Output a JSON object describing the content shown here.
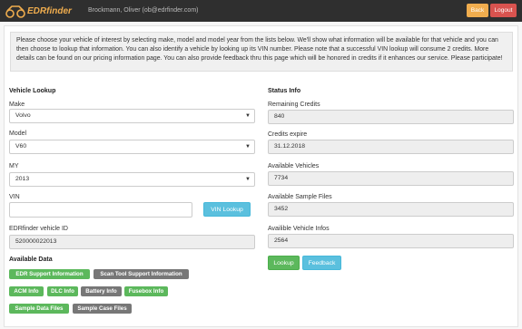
{
  "header": {
    "logo_text": "EDRfinder",
    "user": "Brockmann, Oliver (ob@edrfinder.com)",
    "back_label": "Back",
    "logout_label": "Logout"
  },
  "intro": "Please choose your vehicle of interest by selecting make, model and model year from the lists below. We'll show what information will be available for that vehicle and you can then choose to lookup that information. You can also identify a vehicle by looking up its VIN number. Please note that a successful VIN lookup will consume 2 credits. More details can be found on our pricing information page. You can also provide feedback thru this page which will be honored in credits if it enhances our service. Please participate!",
  "lookup": {
    "title": "Vehicle Lookup",
    "make_label": "Make",
    "make_value": "Volvo",
    "model_label": "Model",
    "model_value": "V60",
    "my_label": "MY",
    "my_value": "2013",
    "vin_label": "VIN",
    "vin_value": "",
    "vin_button": "VIN Lookup",
    "id_label": "EDRfinder vehicle ID",
    "id_value": "520000022013"
  },
  "available": {
    "title": "Available Data",
    "badges": [
      {
        "label": "EDR Support Information",
        "status": "available"
      },
      {
        "label": "Scan Tool Support Information",
        "status": "unavailable"
      },
      {
        "label": "ACM Info",
        "status": "available"
      },
      {
        "label": "DLC Info",
        "status": "available"
      },
      {
        "label": "Battery Info",
        "status": "unavailable"
      },
      {
        "label": "Fusebox Info",
        "status": "available"
      },
      {
        "label": "Sample Data Files",
        "status": "available"
      },
      {
        "label": "Sample Case Files",
        "status": "unavailable"
      }
    ]
  },
  "status": {
    "title": "Status Info",
    "credits_label": "Remaining Credits",
    "credits_value": "840",
    "expire_label": "Credits expire",
    "expire_value": "31.12.2018",
    "vehicles_label": "Available Vehicles",
    "vehicles_value": "7734",
    "samples_label": "Available Sample Files",
    "samples_value": "3452",
    "infos_label": "Availible Vehicle Infos",
    "infos_value": "2564",
    "lookup_button": "Lookup",
    "feedback_button": "Feedback"
  },
  "colors": {
    "navbar": "#2f2f2f",
    "brand": "#f0ad4e",
    "danger": "#d9534f",
    "info": "#5bc0de",
    "success": "#5cb85c",
    "muted": "#777777"
  }
}
